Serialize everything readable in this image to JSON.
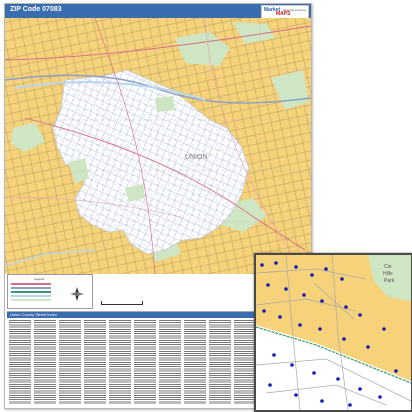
{
  "poster": {
    "title": "ZIP Code 07083",
    "place_label": "UNION",
    "legend_title": "Legend",
    "index_heading": "Union County Street Index"
  },
  "logo": {
    "line1": "Market",
    "line2": "MAPS",
    "small": "Mapping America"
  },
  "inset": {
    "park_label_1": "Cin",
    "park_label_2": "Hills",
    "park_label_3": "Park"
  },
  "colors": {
    "title_bar": "#3a6db0",
    "land_outside": "#f6d27b",
    "zip_area": "#ffffff",
    "parks": "#cfe6c4",
    "water": "#b7d5ee",
    "highway": "#d86a86",
    "rail": "#3a9a6b",
    "inset_points": "#1a1ab4"
  }
}
